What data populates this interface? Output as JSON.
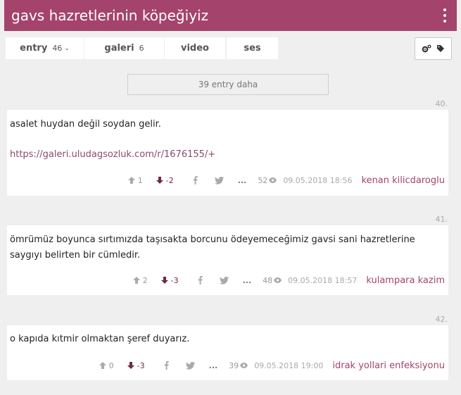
{
  "topic": {
    "title": "gavs hazretlerinin köpeğiyiz"
  },
  "tabs": [
    {
      "label": "entry",
      "count": "46"
    },
    {
      "label": "galeri",
      "count": "6"
    },
    {
      "label": "video",
      "count": ""
    },
    {
      "label": "ses",
      "count": ""
    }
  ],
  "more_entries": "39 entry daha",
  "entries": [
    {
      "number": "40.",
      "lines": [
        "asalet huydan değil soydan gelir."
      ],
      "link": "https://galeri.uludagsozluk.com/r/1676155/+",
      "upvotes": "1",
      "downvotes": "-2",
      "ellipsis": "...",
      "views": "52",
      "date": "09.05.2018 18:56",
      "author": "kenan kilicdaroglu"
    },
    {
      "number": "41.",
      "lines": [
        "ömrümüz boyunca sırtımızda taşısakta borcunu ödeyemeceğimiz gavsi sani hazretlerine",
        "saygıyı belirten bir cümledir."
      ],
      "upvotes": "2",
      "downvotes": "-3",
      "ellipsis": "...",
      "views": "48",
      "date": "09.05.2018 18:57",
      "author": "kulampara kazim"
    },
    {
      "number": "42.",
      "lines": [
        "o kapıda kıtmir olmaktan şeref duyarız."
      ],
      "upvotes": "0",
      "downvotes": "-3",
      "ellipsis": "...",
      "views": "39",
      "date": "09.05.2018 19:00",
      "author": "idrak yollari enfeksiyonu"
    }
  ],
  "colors": {
    "brand": "#a4436b",
    "link": "#8a4a6f",
    "downvote": "#6b2a46"
  },
  "icons": [
    "more-vertical-icon",
    "gears-icon",
    "tag-icon",
    "arrow-up-icon",
    "arrow-down-icon",
    "facebook-icon",
    "twitter-icon",
    "eye-icon"
  ]
}
